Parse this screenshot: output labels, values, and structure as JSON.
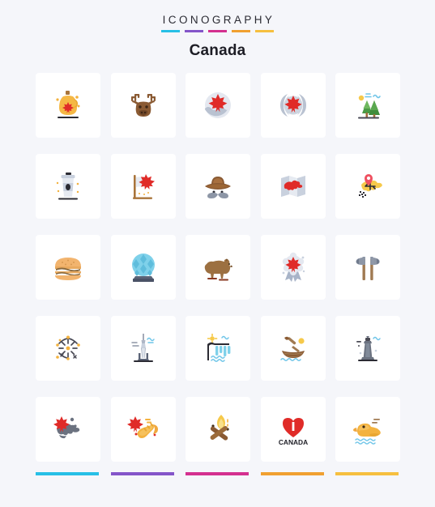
{
  "header": {
    "brand": "ICONOGRAPHY",
    "title": "Canada",
    "rule_colors": [
      "#27bfe6",
      "#8455c9",
      "#d4308f",
      "#f0a030",
      "#f6bf3f"
    ]
  },
  "footer": {
    "rule_colors": [
      "#27bfe6",
      "#8455c9",
      "#d4308f",
      "#f0a030",
      "#f6bf3f"
    ]
  },
  "grid": {
    "columns": 5,
    "rows": 6,
    "card_background": "#ffffff",
    "page_background": "#f5f6fa"
  },
  "icons": [
    {
      "name": "maple-syrup-bottle-icon",
      "label": "Maple Syrup Bottle"
    },
    {
      "name": "moose-head-icon",
      "label": "Moose"
    },
    {
      "name": "maple-leaf-snow-globe-icon",
      "label": "Maple Leaf Snow Badge"
    },
    {
      "name": "maple-leaf-emblem-icon",
      "label": "Maple Leaf Emblem"
    },
    {
      "name": "pine-forest-icon",
      "label": "Pine Forest"
    },
    {
      "name": "coffee-cup-icon",
      "label": "Coffee Cup"
    },
    {
      "name": "canada-flag-pole-icon",
      "label": "Canada Flag"
    },
    {
      "name": "mountie-hat-moustache-icon",
      "label": "Mountie Hat"
    },
    {
      "name": "canada-map-paper-icon",
      "label": "Canada Map"
    },
    {
      "name": "map-location-pin-icon",
      "label": "Map Location Pin"
    },
    {
      "name": "burger-icon",
      "label": "Burger"
    },
    {
      "name": "biosphere-dome-icon",
      "label": "Biosphere Dome"
    },
    {
      "name": "grizzly-bear-icon",
      "label": "Bear"
    },
    {
      "name": "maple-leaf-award-ribbon-icon",
      "label": "Award Ribbon"
    },
    {
      "name": "crossed-axes-icon",
      "label": "Axes"
    },
    {
      "name": "fireworks-icon",
      "label": "Fireworks"
    },
    {
      "name": "cn-tower-icon",
      "label": "CN Tower"
    },
    {
      "name": "waterfall-icon",
      "label": "Waterfall"
    },
    {
      "name": "canoe-paddle-icon",
      "label": "Canoe"
    },
    {
      "name": "lighthouse-icon",
      "label": "Lighthouse"
    },
    {
      "name": "canada-map-leaf-icon",
      "label": "Canada Map with Leaf"
    },
    {
      "name": "trumpet-maple-leaf-icon",
      "label": "Trumpet"
    },
    {
      "name": "campfire-icon",
      "label": "Campfire"
    },
    {
      "name": "i-love-canada-heart-icon",
      "label": "I Love Canada"
    },
    {
      "name": "duck-icon",
      "label": "Duck"
    }
  ],
  "heart_icon_caption": "CANADA"
}
